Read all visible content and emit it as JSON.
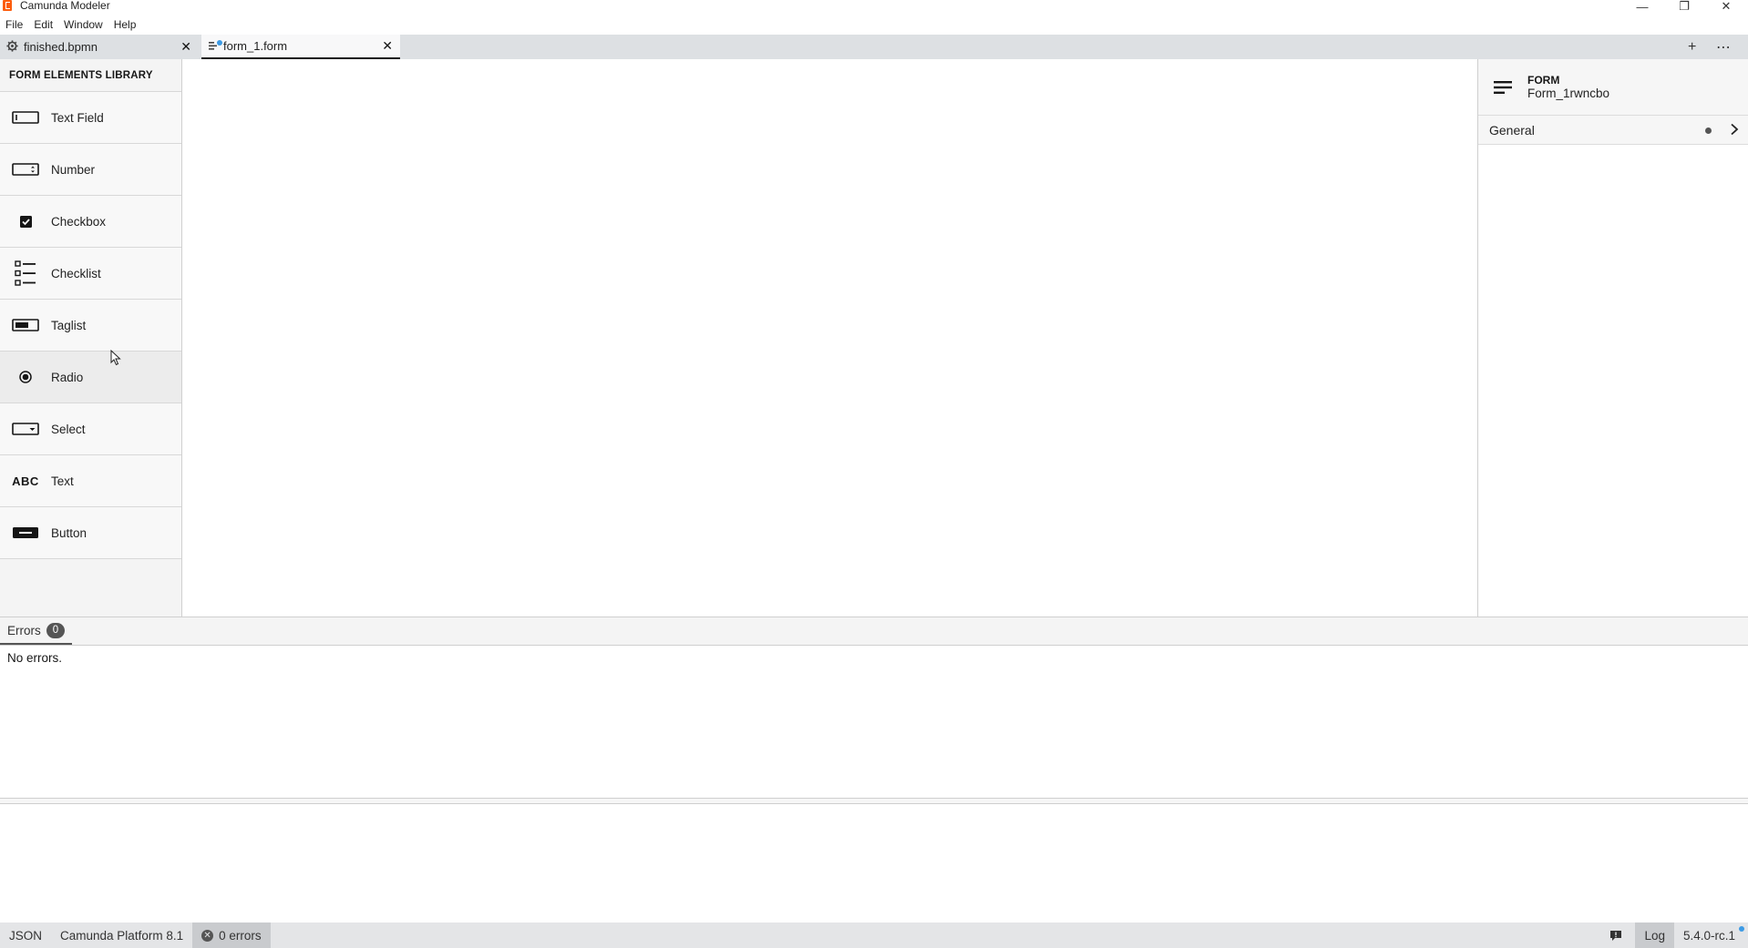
{
  "window": {
    "title": "Camunda Modeler",
    "minimize_glyph": "—",
    "restore_glyph": "❐",
    "close_glyph": "✕"
  },
  "menu": [
    "File",
    "Edit",
    "Window",
    "Help"
  ],
  "tabs": [
    {
      "label": "finished.bpmn",
      "icon": "gear-icon",
      "close": "✕",
      "active": false
    },
    {
      "label": "form_1.form",
      "icon": "form-icon",
      "close": "✕",
      "active": true,
      "unsaved": true
    }
  ],
  "tabbar_actions": {
    "add": "+",
    "more": "⋯"
  },
  "library": {
    "header": "FORM ELEMENTS LIBRARY",
    "items": [
      {
        "label": "Text Field",
        "icon": "textfield-icon"
      },
      {
        "label": "Number",
        "icon": "number-icon"
      },
      {
        "label": "Checkbox",
        "icon": "checkbox-icon"
      },
      {
        "label": "Checklist",
        "icon": "checklist-icon"
      },
      {
        "label": "Taglist",
        "icon": "taglist-icon"
      },
      {
        "label": "Radio",
        "icon": "radio-icon"
      },
      {
        "label": "Select",
        "icon": "select-icon"
      },
      {
        "label": "Text",
        "icon": "text-icon",
        "icon_text": "ABC"
      },
      {
        "label": "Button",
        "icon": "button-icon"
      }
    ]
  },
  "properties": {
    "type": "FORM",
    "name": "Form_1rwncbo",
    "groups": [
      {
        "label": "General",
        "chevron": "›"
      }
    ]
  },
  "bottom_panel": {
    "tab_label": "Errors",
    "count": "0",
    "message": "No errors."
  },
  "statusbar": {
    "format": "JSON",
    "platform": "Camunda Platform 8.1",
    "errors": "0 errors",
    "error_glyph": "✕",
    "log": "Log",
    "version": "5.4.0-rc.1"
  },
  "colors": {
    "brand": "#fc5d0d",
    "accent_dot": "#3d9be5",
    "tabbar_bg": "#dde0e3",
    "statusbar_bg": "#e4e5e7"
  }
}
